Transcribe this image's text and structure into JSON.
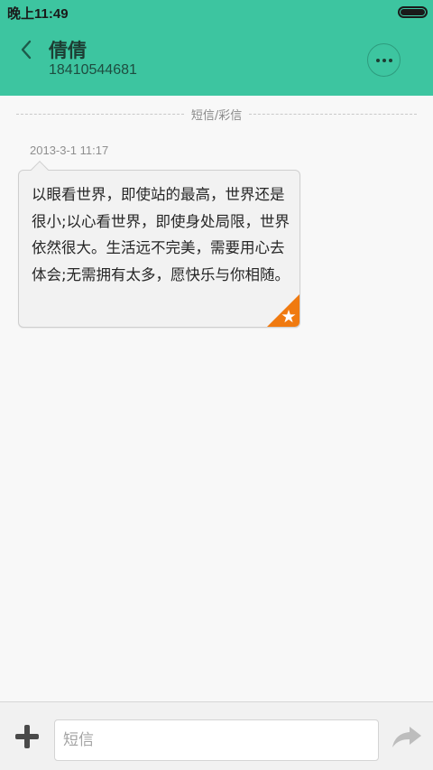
{
  "status_bar": {
    "time": "晚上11:49",
    "battery_level": 1.0
  },
  "header": {
    "contact_name": "倩倩",
    "contact_number": "18410544681",
    "back_icon": "chevron-left-icon",
    "more_icon": "more-horizontal-icon"
  },
  "conversation": {
    "type_label": "短信/彩信",
    "messages": [
      {
        "timestamp": "2013-3-1 11:17",
        "text": "以眼看世界，即使站的最高，世界还是很小;以心看世界，即使身处局限，世界依然很大。生活远不完美，需要用心去体会;无需拥有太多，愿快乐与你相随。",
        "starred": true,
        "star_icon": "star-icon"
      }
    ]
  },
  "composer": {
    "add_icon": "plus-icon",
    "input_placeholder": "短信",
    "input_value": "",
    "send_icon": "send-arrow-icon"
  },
  "colors": {
    "accent": "#3dc5a0",
    "star_badge": "#f07a10",
    "background": "#f8f8f8"
  }
}
